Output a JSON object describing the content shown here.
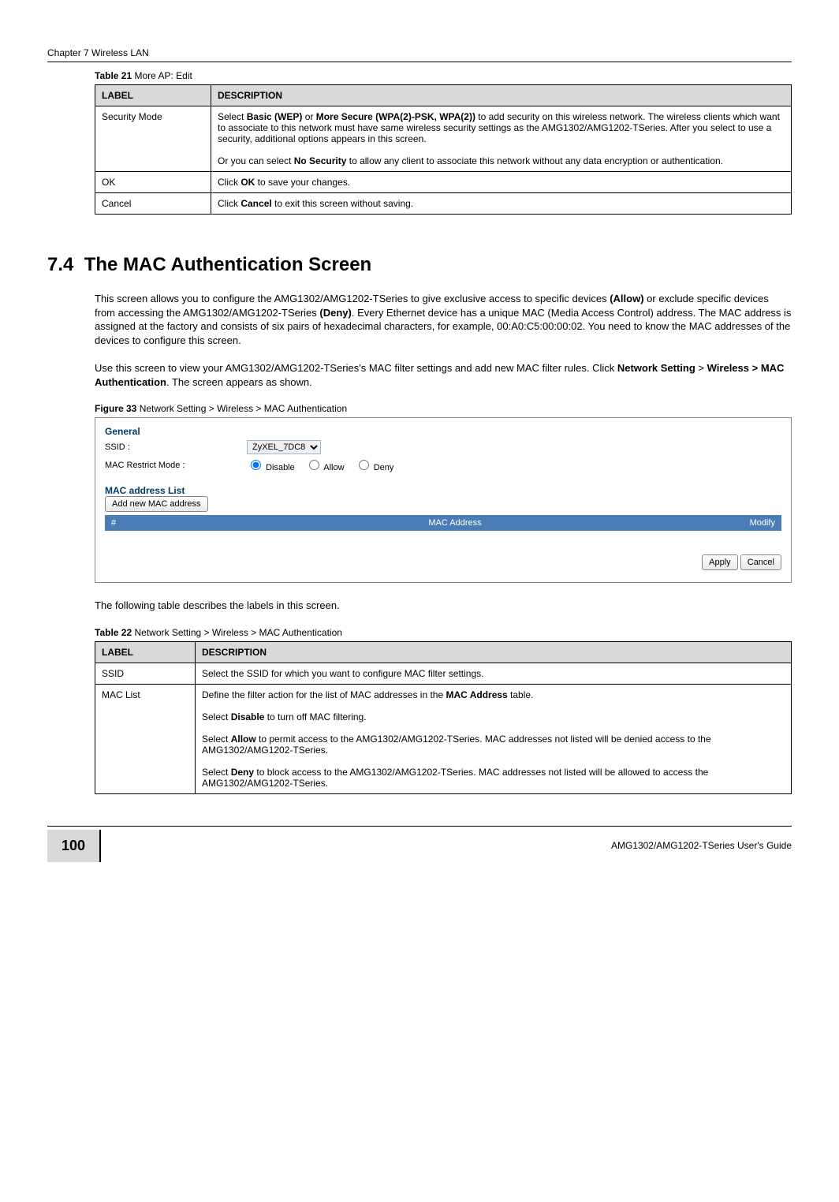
{
  "header": {
    "chapter": "Chapter 7 Wireless LAN"
  },
  "table21": {
    "caption_prefix": "Table 21",
    "caption_rest": "   More AP: Edit",
    "header_label": "LABEL",
    "header_desc": "DESCRIPTION",
    "rows": [
      {
        "label": "Security Mode",
        "desc_parts": {
          "p1a": "Select ",
          "b1": "Basic (WEP)",
          "p1b": " or ",
          "b2": "More Secure (WPA(2)-PSK, WPA(2))",
          "p1c": " to add security on this wireless network. The wireless clients which want to associate to this network must have same wireless security settings as the AMG1302/AMG1202-TSeries. After you select to use a security, additional options appears in this screen.",
          "p2a": "Or you can select ",
          "b3": "No Security",
          "p2b": " to allow any client to associate this network without any data encryption or authentication."
        }
      },
      {
        "label": "OK",
        "desc_parts": {
          "p1a": "Click ",
          "b1": "OK",
          "p1b": " to save your changes."
        }
      },
      {
        "label": "Cancel",
        "desc_parts": {
          "p1a": "Click ",
          "b1": "Cancel",
          "p1b": " to exit this screen without saving."
        }
      }
    ]
  },
  "section": {
    "number": "7.4",
    "title": "The MAC Authentication Screen"
  },
  "paragraphs": {
    "p1": {
      "t1": "This screen allows you to configure the AMG1302/AMG1202-TSeries to give exclusive access to specific devices ",
      "b1": "(Allow)",
      "t2": " or exclude specific devices from accessing the AMG1302/AMG1202-TSeries ",
      "b2": "(Deny)",
      "t3": ". Every Ethernet device has a unique MAC (Media Access Control) address. The MAC address is assigned at the factory and consists of six pairs of hexadecimal characters, for example, 00:A0:C5:00:00:02. You need to know the MAC addresses of the devices to configure this screen."
    },
    "p2": {
      "t1": "Use this screen to view your AMG1302/AMG1202-TSeries's MAC filter settings and add new MAC filter rules. Click ",
      "b1": "Network Setting",
      "t2": " > ",
      "b2": "Wireless > MAC Authentication",
      "t3": ". The screen appears as shown."
    }
  },
  "figure33": {
    "caption_prefix": "Figure 33",
    "caption_rest": "   Network Setting > Wireless > MAC Authentication",
    "general": "General",
    "ssid_label": "SSID :",
    "ssid_value": "ZyXEL_7DC8",
    "restrict_label": "MAC Restrict Mode :",
    "radio_disable": "Disable",
    "radio_allow": "Allow",
    "radio_deny": "Deny",
    "mac_list": "MAC address List",
    "add_btn": "Add new MAC address",
    "col_num": "#",
    "col_mac": "MAC Address",
    "col_modify": "Modify",
    "apply": "Apply",
    "cancel": "Cancel"
  },
  "followup": "The following table describes the labels in this screen.",
  "table22": {
    "caption_prefix": "Table 22",
    "caption_rest": "   Network Setting > Wireless > MAC Authentication",
    "header_label": "LABEL",
    "header_desc": "DESCRIPTION",
    "rows": [
      {
        "label": "SSID",
        "desc_plain": "Select the SSID for which you want to configure MAC filter settings."
      },
      {
        "label": "MAC List",
        "desc_parts": {
          "p1a": "Define the filter action for the list of MAC addresses in the ",
          "b1": "MAC Address",
          "p1b": " table.",
          "p2a": "Select ",
          "b2": "Disable",
          "p2b": " to turn off MAC filtering.",
          "p3a": "Select ",
          "b3": "Allow",
          "p3b": " to permit access to the AMG1302/AMG1202-TSeries. MAC addresses not listed will be denied access to the AMG1302/AMG1202-TSeries.",
          "p4a": "Select ",
          "b4": "Deny",
          "p4b": " to block access to the AMG1302/AMG1202-TSeries. MAC addresses not listed will be allowed to access the AMG1302/AMG1202-TSeries."
        }
      }
    ]
  },
  "footer": {
    "page_number": "100",
    "guide": "AMG1302/AMG1202-TSeries User's Guide"
  }
}
